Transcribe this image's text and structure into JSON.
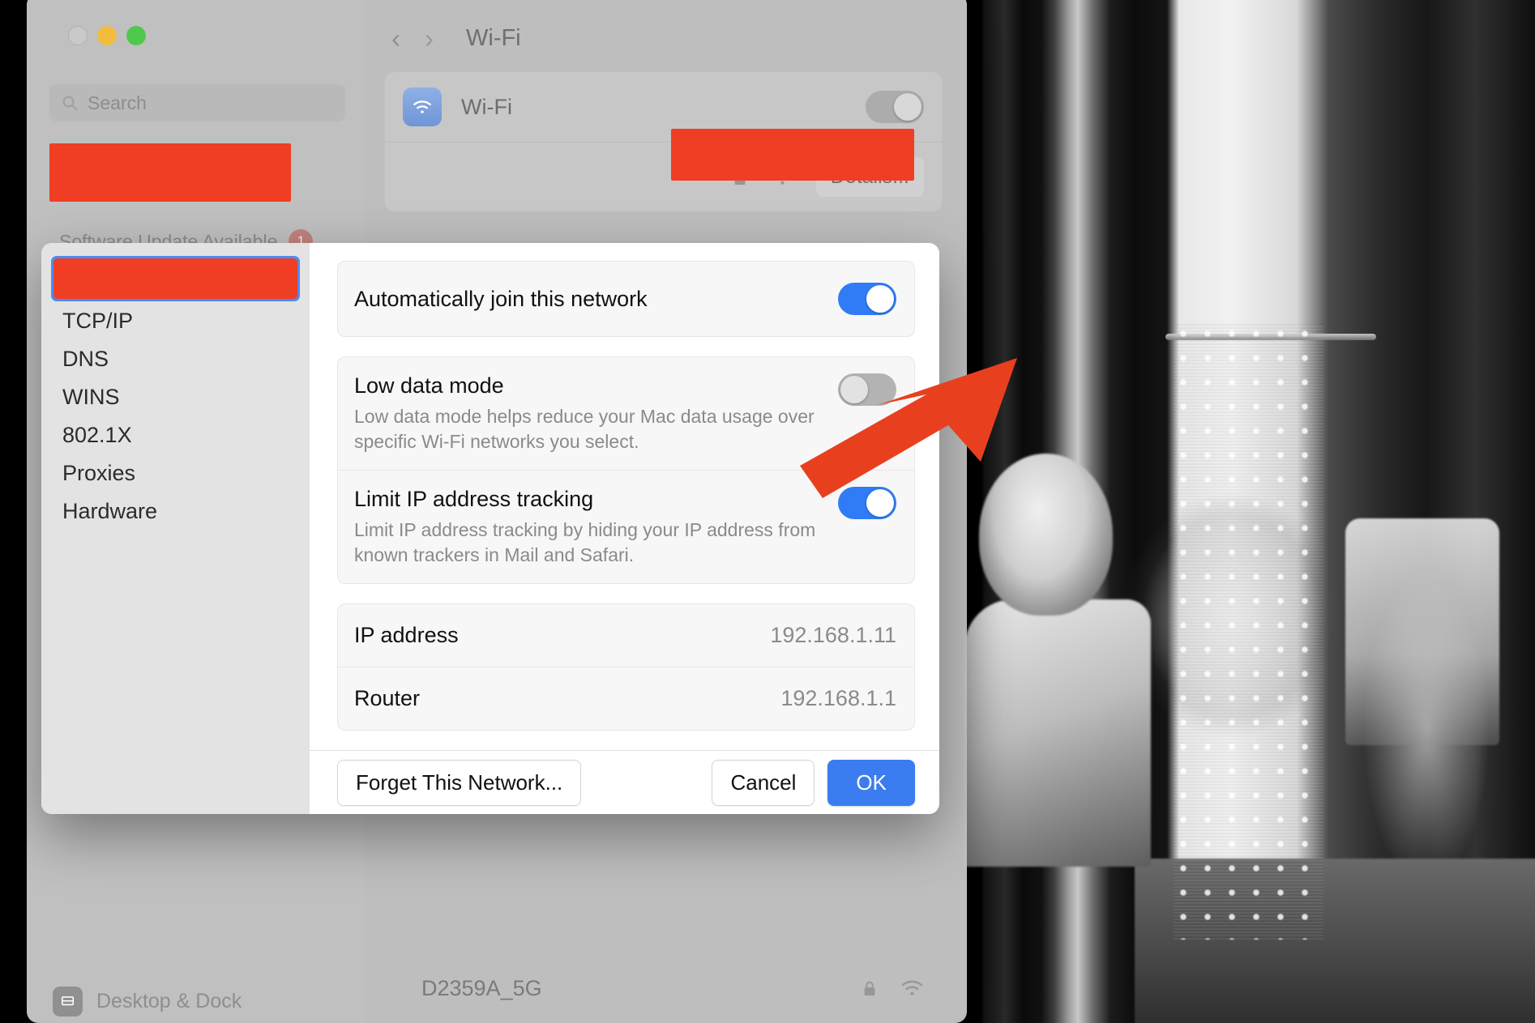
{
  "window": {
    "title": "Wi-Fi",
    "traffic_lights": [
      "close",
      "minimize",
      "maximize"
    ]
  },
  "sidebar": {
    "search": {
      "placeholder": "Search",
      "value": "",
      "icon": "search-icon"
    },
    "account_redacted": true,
    "software_update": {
      "label": "Software Update Available",
      "badge": "1"
    },
    "icons": [
      {
        "name": "wifi-icon",
        "color": "#7ba3de",
        "glyph": "◔",
        "selected": true
      },
      {
        "name": "bluetooth-icon",
        "color": "#6f9ada",
        "glyph": "ᛗ",
        "selected": false
      },
      {
        "name": "network-icon",
        "color": "#6f9ada",
        "glyph": "⊕",
        "selected": false
      },
      {
        "name": "vpn-icon",
        "color": "#6f9ada",
        "glyph": "⊖",
        "selected": false
      },
      {
        "name": "notifications-icon",
        "color": "#d98d8d",
        "glyph": "▲",
        "selected": false
      },
      {
        "name": "sound-icon",
        "color": "#d58b8b",
        "glyph": "◀",
        "selected": false
      },
      {
        "name": "focus-icon",
        "color": "#8b87c9",
        "glyph": "☾",
        "selected": false
      },
      {
        "name": "screen-time-icon",
        "color": "#7f7bc2",
        "glyph": "⌛",
        "selected": false
      },
      {
        "name": "general-icon",
        "color": "#a9a9a9",
        "glyph": "⚙",
        "selected": false
      },
      {
        "name": "appearance-icon",
        "color": "#4f4f4f",
        "glyph": "◑",
        "selected": false
      },
      {
        "name": "accessibility-icon",
        "color": "#7ba3de",
        "glyph": "☺",
        "selected": false
      }
    ],
    "bottom_item": {
      "label": "Desktop & Dock",
      "icon": "desktop-dock-icon"
    }
  },
  "detail": {
    "nav": {
      "back": "‹",
      "forward": "›",
      "title": "Wi-Fi"
    },
    "wifi_row": {
      "label": "Wi-Fi",
      "icon": "wifi-app-icon",
      "toggle_state": "off"
    },
    "network_row": {
      "name_redacted": true,
      "lock_icon": "lock-icon",
      "signal_icon": "wifi-signal-icon",
      "details_button": "Details..."
    },
    "background_network": {
      "name": "D2359A_5G",
      "lock_icon": "lock-icon",
      "signal_icon": "wifi-signal-icon"
    }
  },
  "sheet": {
    "sidebar_items": [
      {
        "label": "",
        "redacted": true,
        "active": true
      },
      {
        "label": "TCP/IP",
        "redacted": false,
        "active": false
      },
      {
        "label": "DNS",
        "redacted": false,
        "active": false
      },
      {
        "label": "WINS",
        "redacted": false,
        "active": false
      },
      {
        "label": "802.1X",
        "redacted": false,
        "active": false
      },
      {
        "label": "Proxies",
        "redacted": false,
        "active": false
      },
      {
        "label": "Hardware",
        "redacted": false,
        "active": false
      }
    ],
    "settings": [
      {
        "title": "Automatically join this network",
        "description": "",
        "toggle": "on"
      },
      {
        "title": "Low data mode",
        "description": "Low data mode helps reduce your Mac data usage over specific Wi-Fi networks you select.",
        "toggle": "off"
      },
      {
        "title": "Limit IP address tracking",
        "description": "Limit IP address tracking by hiding your IP address from known trackers in Mail and Safari.",
        "toggle": "on"
      }
    ],
    "info": [
      {
        "key": "IP address",
        "value": "192.168.1.11"
      },
      {
        "key": "Router",
        "value": "192.168.1.1"
      }
    ],
    "footer": {
      "forget": "Forget This Network...",
      "cancel": "Cancel",
      "ok": "OK"
    }
  },
  "annotation": {
    "arrow_color": "#e8401f",
    "points_at": "Automatically join this network toggle"
  },
  "colors": {
    "redaction": "#ef3e23",
    "accent_blue": "#3b7df0",
    "toggle_on": "#2f7cf6",
    "selection_blue": "#4a8cf0"
  }
}
